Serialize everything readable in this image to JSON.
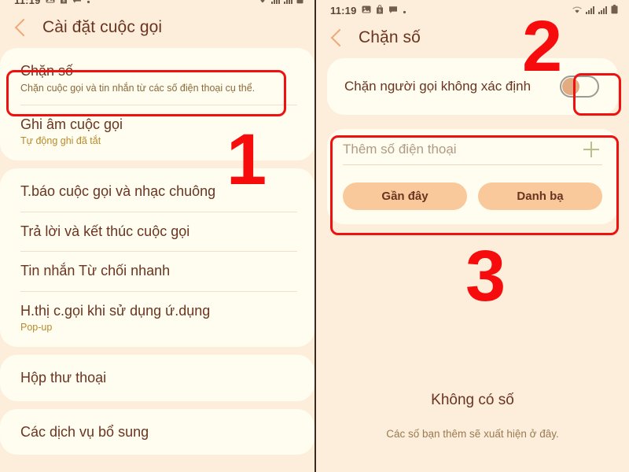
{
  "left": {
    "statusbar": {
      "time": "11:19",
      "icons": [
        "image-icon",
        "shopping-bag-icon",
        "chat-icon",
        "dot-icon"
      ],
      "right_icons": [
        "wifi-icon",
        "signal-icon",
        "signal-icon",
        "battery-icon"
      ]
    },
    "appbar": {
      "back": "back-chevron-icon",
      "title": "Cài đặt cuộc gọi"
    },
    "groups": [
      {
        "rows": [
          {
            "title": "Chặn số",
            "sub": "Chặn cuộc gọi và tin nhắn từ các số điện thoại cụ thể."
          },
          {
            "title": "Ghi âm cuộc gọi",
            "sub": "Tự động ghi đã tắt"
          }
        ]
      },
      {
        "rows": [
          {
            "title": "T.báo cuộc gọi và nhạc chuông",
            "sub": ""
          },
          {
            "title": "Trả lời và kết thúc cuộc gọi",
            "sub": ""
          },
          {
            "title": "Tin nhắn Từ chối nhanh",
            "sub": ""
          },
          {
            "title": "H.thị c.gọi khi sử dụng ứ.dụng",
            "sub": "Pop-up"
          }
        ]
      },
      {
        "rows": [
          {
            "title": "Hộp thư thoại",
            "sub": ""
          }
        ]
      },
      {
        "rows": [
          {
            "title": "Các dịch vụ bổ sung",
            "sub": ""
          }
        ]
      }
    ]
  },
  "right": {
    "statusbar": {
      "time": "11:19",
      "icons": [
        "image-icon",
        "shopping-bag-icon",
        "chat-icon",
        "dot-icon"
      ],
      "right_icons": [
        "wifi-icon",
        "signal-icon",
        "signal-icon",
        "battery-icon"
      ]
    },
    "appbar": {
      "back": "back-chevron-icon",
      "title": "Chặn số"
    },
    "toggle": {
      "label": "Chặn người gọi không xác định",
      "state": "off"
    },
    "add": {
      "placeholder": "Thêm số điện thoại",
      "value": "",
      "plus": "plus-icon",
      "recent_label": "Gần đây",
      "contacts_label": "Danh bạ"
    },
    "empty": {
      "title": "Không có số",
      "subtitle": "Các số bạn thêm sẽ xuất hiện ở đây."
    }
  },
  "annotations": {
    "numbers": [
      "1",
      "2",
      "3"
    ],
    "color": "#f60c0c"
  },
  "colors": {
    "page_bg": "#fceedb",
    "card_bg": "#fffdef",
    "title_text": "#6a3421",
    "pill_bg": "#f9c99b",
    "accent": "#f0a878"
  }
}
